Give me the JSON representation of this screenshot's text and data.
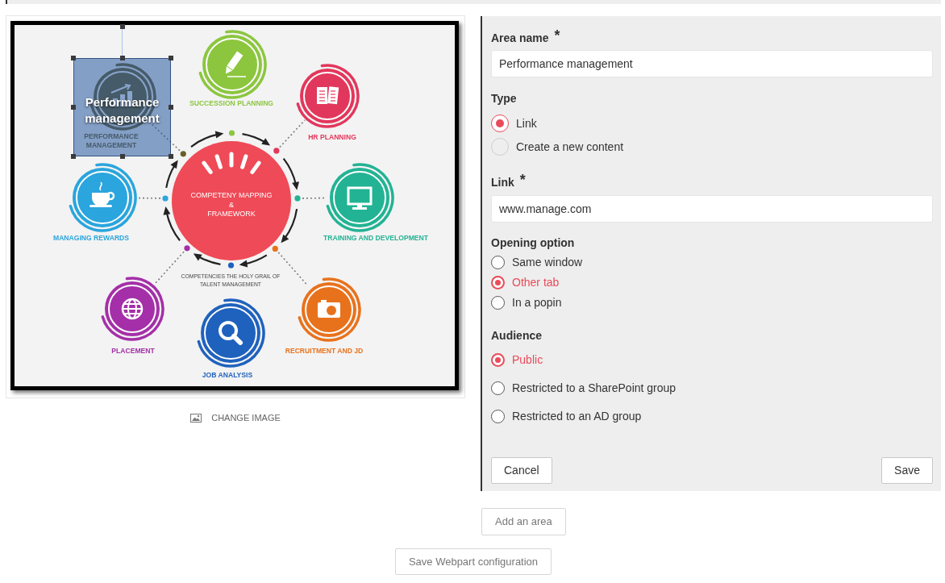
{
  "image": {
    "center": {
      "lines": [
        "COMPETENY MAPPING",
        "&",
        "FRAMEWORK"
      ]
    },
    "caption": {
      "lines": [
        "COMPETENCIES THE HOLY GRAIL OF",
        "TALENT MANAGEMENT"
      ]
    },
    "nodes": [
      {
        "kind": "chart",
        "color": "#6a5d27",
        "label": [
          "PERFORMANCE",
          "MANAGEMENT"
        ]
      },
      {
        "kind": "pencil",
        "color": "#8cc63f",
        "label": [
          "SUCCESSION PLANNING"
        ]
      },
      {
        "kind": "document",
        "color": "#e2375c",
        "label": [
          "HR PLANNING"
        ]
      },
      {
        "kind": "monitor",
        "color": "#22b394",
        "label": [
          "TRAINING AND DEVELOPMENT"
        ]
      },
      {
        "kind": "camera",
        "color": "#e8721c",
        "label": [
          "RECRUITMENT AND JD"
        ]
      },
      {
        "kind": "search",
        "color": "#1f62bd",
        "label": [
          "JOB ANALYSIS"
        ]
      },
      {
        "kind": "globe",
        "color": "#a42fa8",
        "label": [
          "PLACEMENT"
        ]
      },
      {
        "kind": "cup",
        "color": "#2aa5dd",
        "label": [
          "MANAGING REWARDS"
        ]
      }
    ],
    "area": {
      "label": "Performance management",
      "selected": true
    }
  },
  "change_image": {
    "label": "CHANGE IMAGE"
  },
  "form": {
    "area_name": {
      "label": "Area name",
      "required_mark": "*",
      "value": "Performance management"
    },
    "type": {
      "label": "Type",
      "options": [
        {
          "label": "Link",
          "selected": true
        },
        {
          "label": "Create a new content",
          "selected": false
        }
      ]
    },
    "link": {
      "label": "Link",
      "required_mark": "*",
      "value": "www.manage.com"
    },
    "opening_option": {
      "label": "Opening option",
      "options": [
        {
          "label": "Same window",
          "selected": false
        },
        {
          "label": "Other tab",
          "selected": true
        },
        {
          "label": "In a popin",
          "selected": false
        }
      ]
    },
    "audience": {
      "label": "Audience",
      "options": [
        {
          "label": "Public",
          "selected": true
        },
        {
          "label": "Restricted to a SharePoint group",
          "selected": false
        },
        {
          "label": "Restricted to an AD group",
          "selected": false
        }
      ]
    },
    "cancel": "Cancel",
    "save": "Save"
  },
  "add_area": "Add an area",
  "save_configuration": "Save Webpart configuration"
}
